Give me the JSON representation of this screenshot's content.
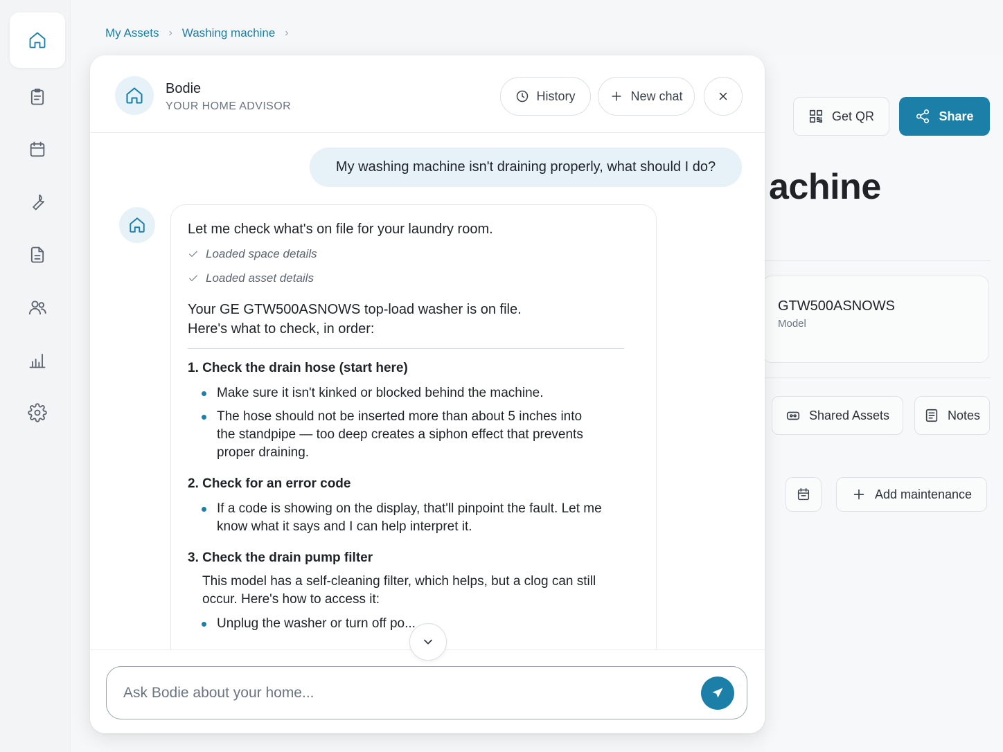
{
  "breadcrumb": {
    "items": [
      "My Assets",
      "Washing machine"
    ]
  },
  "sidebar": {
    "items": [
      {
        "icon": "home-icon",
        "active": true
      },
      {
        "icon": "clipboard-icon"
      },
      {
        "icon": "calendar-icon"
      },
      {
        "icon": "wrench-icon"
      },
      {
        "icon": "document-icon"
      },
      {
        "icon": "users-icon"
      },
      {
        "icon": "bar-chart-icon"
      },
      {
        "icon": "settings-icon"
      }
    ]
  },
  "background_page": {
    "get_qr_label": "Get QR",
    "share_label": "Share",
    "title_fragment": "achine",
    "model_value": "GTW500ASNOWS",
    "model_label": "Model",
    "shared_assets_label": "Shared Assets",
    "notes_label": "Notes",
    "add_maintenance_label": "Add maintenance"
  },
  "chat": {
    "bot_name": "Bodie",
    "bot_subtitle": "YOUR HOME ADVISOR",
    "history_label": "History",
    "new_chat_label": "New chat",
    "user_message": "My washing machine isn't draining properly, what should I do?",
    "reply": {
      "intro": "Let me check what's on file for your laundry room.",
      "status": [
        "Loaded space details",
        "Loaded asset details"
      ],
      "summary_line1": "Your GE GTW500ASNOWS top-load washer is on file.",
      "summary_line2": "Here's what to check, in order:",
      "steps": [
        {
          "title": "1. Check the drain hose (start here)",
          "bullets": [
            "Make sure it isn't kinked or blocked behind the machine.",
            "The hose should not be inserted more than about 5 inches into the standpipe — too deep creates a siphon effect that prevents proper draining."
          ]
        },
        {
          "title": "2. Check for an error code",
          "bullets": [
            "If a code is showing on the display, that'll pinpoint the fault. Let me know what it says and I can help interpret it."
          ]
        },
        {
          "title": "3. Check the drain pump filter",
          "paragraph": "This model has a self-cleaning filter, which helps, but a clog can still occur. Here's how to access it:",
          "bullets": [
            "Unplug the washer or turn off po..."
          ]
        }
      ]
    },
    "input_placeholder": "Ask Bodie about your home..."
  },
  "colors": {
    "accent": "#1b7fa8",
    "bubble": "#e6f2f7"
  }
}
